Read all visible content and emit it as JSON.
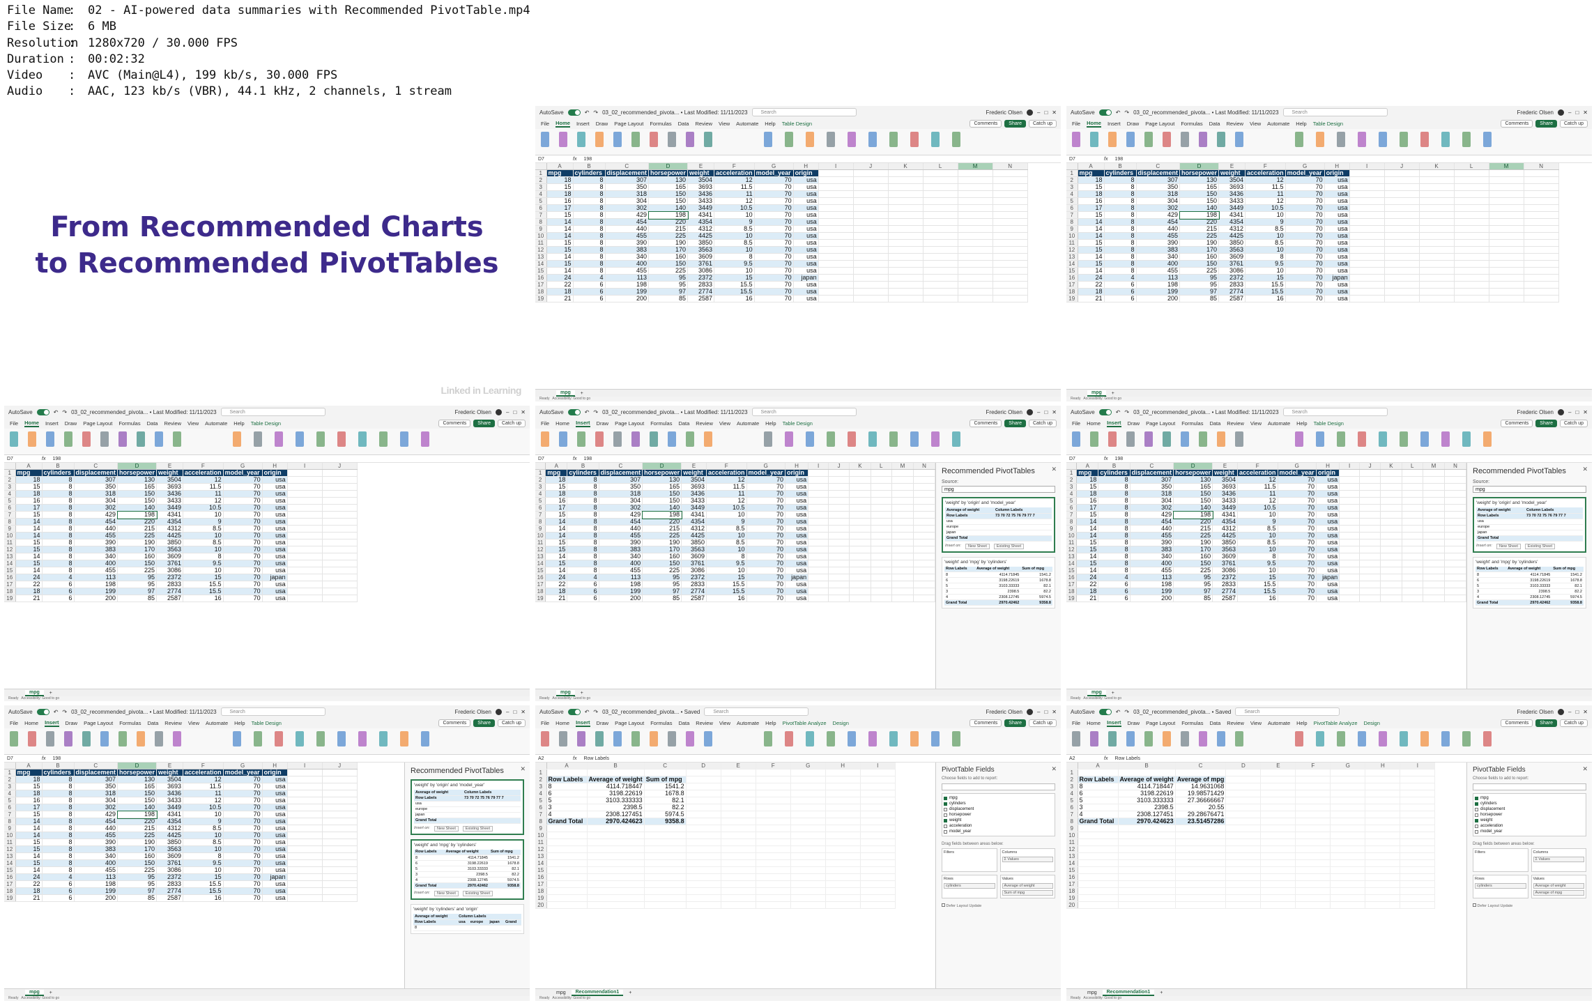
{
  "meta": {
    "rows": [
      {
        "key": "File Name",
        "value": "02 - AI-powered data summaries with Recommended PivotTable.mp4"
      },
      {
        "key": "File Size",
        "value": "6 MB"
      },
      {
        "key": "Resolution",
        "value": "1280x720 / 30.000 FPS"
      },
      {
        "key": "Duration",
        "value": "00:02:32"
      },
      {
        "key": "Video",
        "value": "AVC (Main@L4), 199 kb/s, 30.000 FPS"
      },
      {
        "key": "Audio",
        "value": "AAC, 123 kb/s (VBR), 44.1 kHz, 2 channels, 1 stream"
      }
    ]
  },
  "slide": {
    "title_line1": "From Recommended Charts",
    "title_line2": "to Recommended PivotTables",
    "watermark": "Linked in Learning"
  },
  "excel": {
    "autosave": "AutoSave",
    "file_title": "03_02_recommended_pivota... • Last Modified: 11/11/2023",
    "file_title_saved": "03_02_recommended_pivota... • Saved",
    "search_placeholder": "Search",
    "user": "Frederic Olsen",
    "menu": [
      "File",
      "Home",
      "Insert",
      "Draw",
      "Page Layout",
      "Formulas",
      "Data",
      "Review",
      "View",
      "Automate",
      "Help"
    ],
    "ctx_table": "Table Design",
    "ctx_pivot1": "PivotTable Analyze",
    "ctx_pivot2": "Design",
    "comments": "Comments",
    "share": "Share",
    "catchup": "Catch up",
    "cell_ref": "D7",
    "fx": "fx",
    "formula": "198",
    "cell_ref_pivot": "A2",
    "formula_pivot": "Row Labels",
    "sheet_mpg": "mpg",
    "sheet_rec": "Recommendation1",
    "status_ready": "Ready",
    "status_access": "Accessibility: Good to go",
    "status_display": "Display Settings",
    "cols": [
      "A",
      "B",
      "C",
      "D",
      "E",
      "F",
      "G",
      "H",
      "I",
      "J",
      "K",
      "L",
      "M",
      "N"
    ],
    "headers": [
      "mpg",
      "cylinders",
      "displacement",
      "horsepower",
      "weight",
      "acceleration",
      "model_year",
      "origin"
    ],
    "rows": [
      [
        "18",
        "8",
        "307",
        "130",
        "3504",
        "12",
        "70",
        "usa"
      ],
      [
        "15",
        "8",
        "350",
        "165",
        "3693",
        "11.5",
        "70",
        "usa"
      ],
      [
        "18",
        "8",
        "318",
        "150",
        "3436",
        "11",
        "70",
        "usa"
      ],
      [
        "16",
        "8",
        "304",
        "150",
        "3433",
        "12",
        "70",
        "usa"
      ],
      [
        "17",
        "8",
        "302",
        "140",
        "3449",
        "10.5",
        "70",
        "usa"
      ],
      [
        "15",
        "8",
        "429",
        "198",
        "4341",
        "10",
        "70",
        "usa"
      ],
      [
        "14",
        "8",
        "454",
        "220",
        "4354",
        "9",
        "70",
        "usa"
      ],
      [
        "14",
        "8",
        "440",
        "215",
        "4312",
        "8.5",
        "70",
        "usa"
      ],
      [
        "14",
        "8",
        "455",
        "225",
        "4425",
        "10",
        "70",
        "usa"
      ],
      [
        "15",
        "8",
        "390",
        "190",
        "3850",
        "8.5",
        "70",
        "usa"
      ],
      [
        "15",
        "8",
        "383",
        "170",
        "3563",
        "10",
        "70",
        "usa"
      ],
      [
        "14",
        "8",
        "340",
        "160",
        "3609",
        "8",
        "70",
        "usa"
      ],
      [
        "15",
        "8",
        "400",
        "150",
        "3761",
        "9.5",
        "70",
        "usa"
      ],
      [
        "14",
        "8",
        "455",
        "225",
        "3086",
        "10",
        "70",
        "usa"
      ],
      [
        "24",
        "4",
        "113",
        "95",
        "2372",
        "15",
        "70",
        "japan"
      ],
      [
        "22",
        "6",
        "198",
        "95",
        "2833",
        "15.5",
        "70",
        "usa"
      ],
      [
        "18",
        "6",
        "199",
        "97",
        "2774",
        "15.5",
        "70",
        "usa"
      ],
      [
        "21",
        "6",
        "200",
        "85",
        "2587",
        "16",
        "70",
        "usa"
      ]
    ]
  },
  "recpane": {
    "title": "Recommended PivotTables",
    "source_label": "Source:",
    "source_value": "mpg",
    "card1_title": "'weight' by 'origin' and 'model_year'",
    "card1_h1": "Average of weight",
    "card1_h2": "Column Labels",
    "card1_rowlabels": "Row Labels",
    "card1_years": "73  70  72  75  76  79  77  7",
    "card1_rows": [
      "usa",
      "europe",
      "japan"
    ],
    "card1_total": "Grand Total",
    "insert_on": "Insert on:",
    "new_sheet": "New Sheet",
    "existing_sheet": "Existing Sheet",
    "card2_title": "'weight' and 'mpg' by 'cylinders'",
    "card2_h": [
      "Row Labels",
      "Average of weight",
      "Sum of mpg"
    ],
    "card2_rows": [
      [
        "8",
        "4114.71845",
        "1541.2"
      ],
      [
        "6",
        "3198.22619",
        "1678.8"
      ],
      [
        "5",
        "3103.33333",
        "82.1"
      ],
      [
        "3",
        "2398.5",
        "82.2"
      ],
      [
        "4",
        "2308.12745",
        "5974.5"
      ]
    ],
    "card2_total": [
      "Grand Total",
      "2970.42462",
      "9358.8"
    ],
    "card3_title": "'weight' by 'cylinders' and 'origin'",
    "card3_h1": "Average of weight",
    "card3_h2": "Column Labels",
    "card3_h3": [
      "Row Labels",
      "usa",
      "europe",
      "japan",
      "Grand"
    ],
    "card3_row": [
      "8",
      "",
      "",
      "",
      ""
    ]
  },
  "pivot": {
    "headers": [
      "Row Labels",
      "Average of weight",
      "Sum of mpg"
    ],
    "headers_b": [
      "Row Labels",
      "Average of weight",
      "Average of mpg"
    ],
    "rows": [
      [
        "8",
        "4114.718447",
        "1541.2"
      ],
      [
        "6",
        "3198.22619",
        "1678.8"
      ],
      [
        "5",
        "3103.333333",
        "82.1"
      ],
      [
        "3",
        "2398.5",
        "82.2"
      ],
      [
        "4",
        "2308.127451",
        "5974.5"
      ]
    ],
    "rows_b": [
      [
        "8",
        "4114.718447",
        "14.9631068"
      ],
      [
        "6",
        "3198.22619",
        "19.98571429"
      ],
      [
        "5",
        "3103.333333",
        "27.36666667"
      ],
      [
        "3",
        "2398.5",
        "20.55"
      ],
      [
        "4",
        "2308.127451",
        "29.28676471"
      ]
    ],
    "total": [
      "Grand Total",
      "2970.424623",
      "9358.8"
    ],
    "total_b": [
      "Grand Total",
      "2970.424623",
      "23.51457286"
    ]
  },
  "fields": {
    "title": "PivotTable Fields",
    "sub": "Choose fields to add to report:",
    "list": [
      {
        "name": "mpg",
        "on": true
      },
      {
        "name": "cylinders",
        "on": true
      },
      {
        "name": "displacement",
        "on": false
      },
      {
        "name": "horsepower",
        "on": false
      },
      {
        "name": "weight",
        "on": true
      },
      {
        "name": "acceleration",
        "on": false
      },
      {
        "name": "model_year",
        "on": false
      }
    ],
    "drag": "Drag fields between areas below:",
    "filters": "Filters",
    "columns": "Columns",
    "rows": "Rows",
    "values": "Values",
    "col_pill": "Σ Values",
    "row_pill": "cylinders",
    "val_pill1": "Average of weight",
    "val_pill2": "Sum of mpg",
    "val_pill2_b": "Average of mpg",
    "defer": "Defer Layout Update"
  }
}
